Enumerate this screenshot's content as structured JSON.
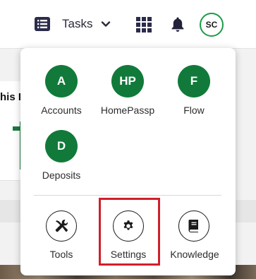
{
  "header": {
    "tasks_label": "Tasks",
    "avatar_initials": "SC"
  },
  "background": {
    "card_text": "his I"
  },
  "launcher": {
    "apps": [
      {
        "initials": "A",
        "label": "Accounts"
      },
      {
        "initials": "HP",
        "label": "HomePassp"
      },
      {
        "initials": "F",
        "label": "Flow"
      },
      {
        "initials": "D",
        "label": "Deposits"
      }
    ],
    "tools": [
      {
        "icon": "tools-icon",
        "label": "Tools"
      },
      {
        "icon": "gear-icon",
        "label": "Settings"
      },
      {
        "icon": "book-icon",
        "label": "Knowledge"
      }
    ]
  },
  "colors": {
    "brand_green": "#117a3a",
    "avatar_ring": "#1e9a4b",
    "highlight": "#d0202a"
  }
}
